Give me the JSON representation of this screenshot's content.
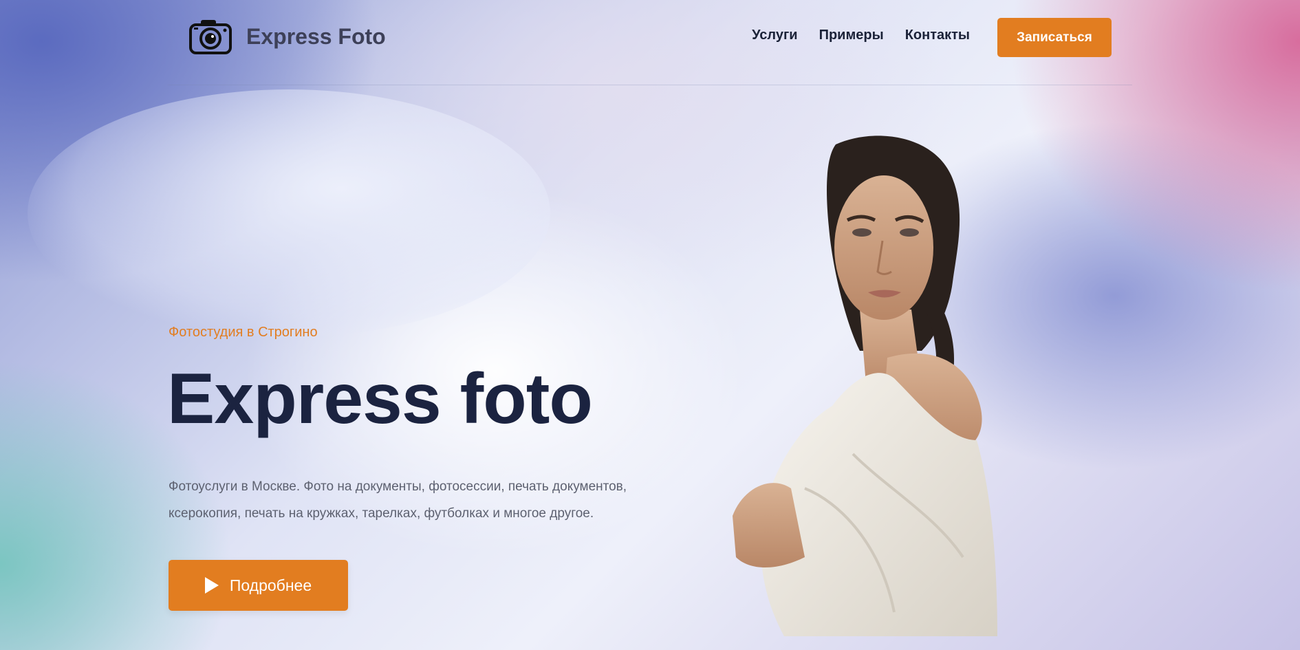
{
  "header": {
    "brand": "Express Foto",
    "logo_icon": "camera-icon",
    "nav": [
      {
        "label": "Услуги"
      },
      {
        "label": "Примеры"
      },
      {
        "label": "Контакты"
      }
    ],
    "cta_label": "Записаться"
  },
  "hero": {
    "eyebrow": "Фотостудия в Строгино",
    "title": "Express foto",
    "description": "Фотоуслуги в Москве. Фото на документы, фотосессии, печать документов, ксерокопия, печать на кружках, тарелках, футболках и многое другое.",
    "button_label": "Подробнее",
    "button_icon": "play-icon"
  },
  "colors": {
    "accent": "#e27d20",
    "title": "#1b2340",
    "text": "#5d6170"
  }
}
